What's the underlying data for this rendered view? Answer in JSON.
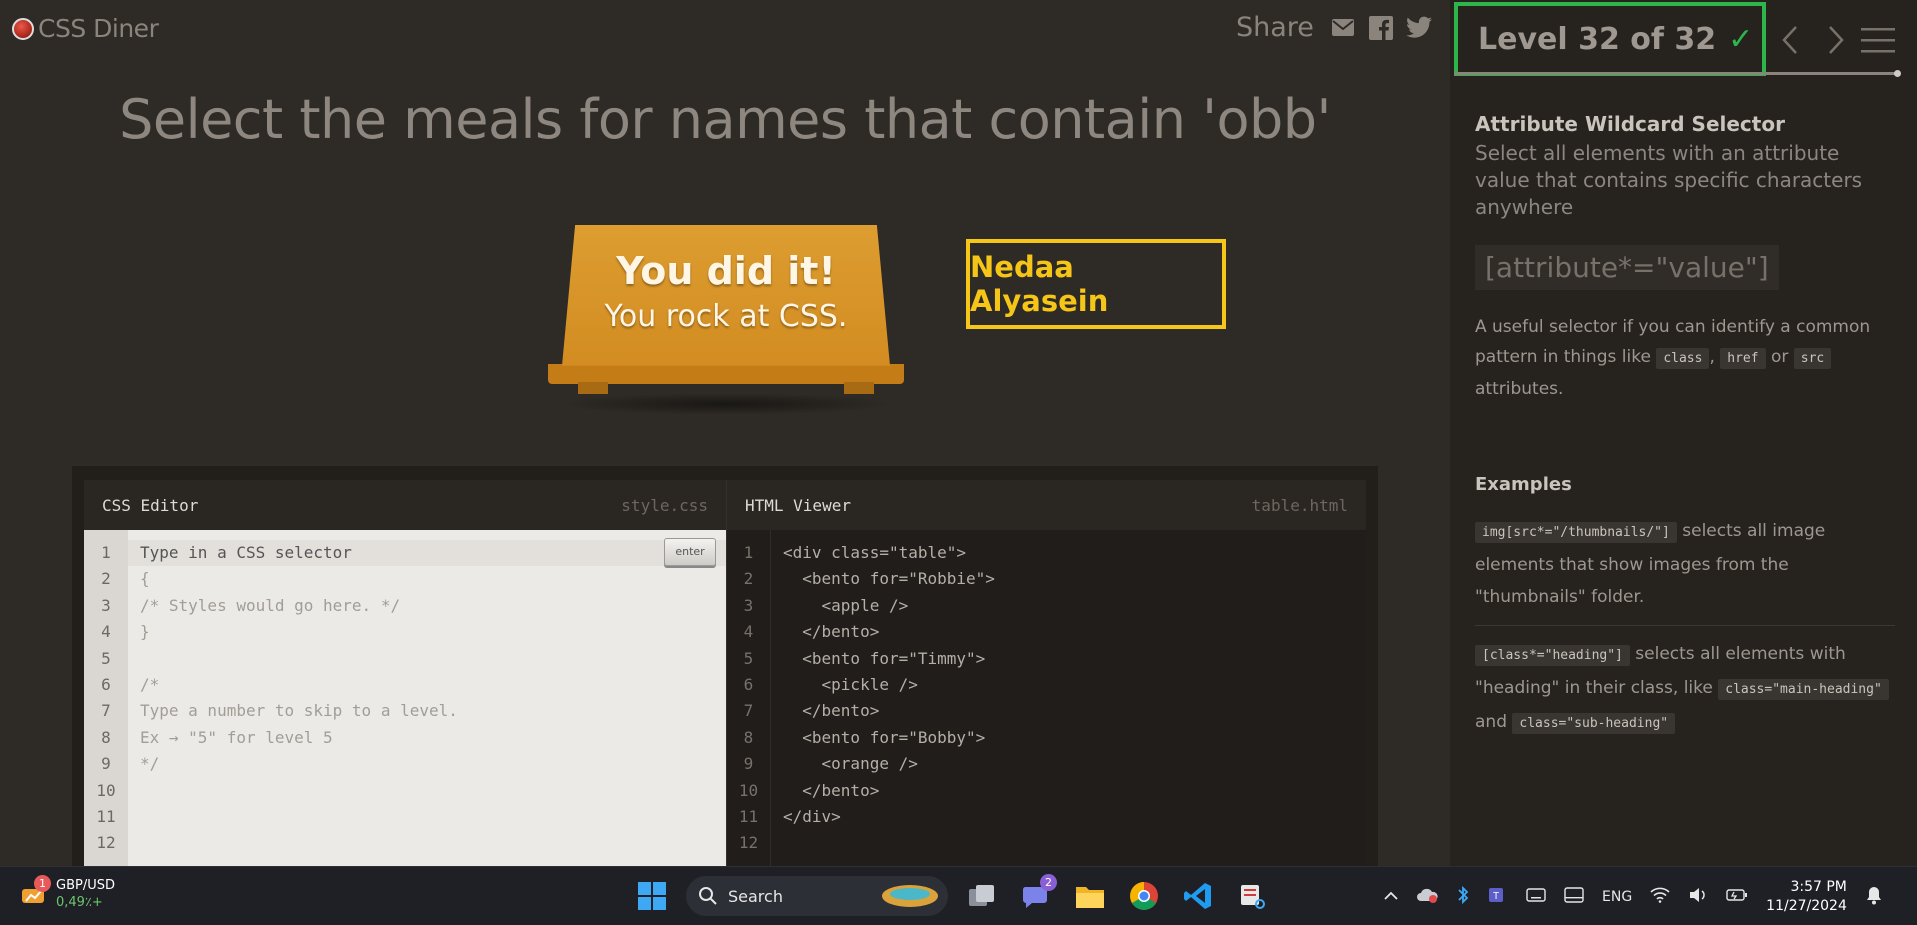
{
  "app": {
    "logo_text": "CSS Diner"
  },
  "share": {
    "label": "Share",
    "icons": [
      "mail-icon",
      "facebook-icon",
      "twitter-icon"
    ]
  },
  "order": "Select the meals for names that contain 'obb'",
  "table": {
    "title": "You did it!",
    "subtitle": "You rock at CSS."
  },
  "name_box": "Nedaa Alyasein",
  "css_editor": {
    "title": "CSS Editor",
    "file": "style.css",
    "enter_label": "enter",
    "line_numbers": [
      "1",
      "2",
      "3",
      "4",
      "5",
      "6",
      "7",
      "8",
      "9",
      "10",
      "11",
      "12"
    ],
    "lines": [
      "Type in a CSS selector",
      "{",
      "/* Styles would go here. */",
      "}",
      "",
      "/*",
      "Type a number to skip to a level.",
      "Ex → \"5\" for level 5",
      "*/",
      "",
      "",
      ""
    ]
  },
  "html_viewer": {
    "title": "HTML Viewer",
    "file": "table.html",
    "line_numbers": [
      "1",
      "2",
      "3",
      "4",
      "5",
      "6",
      "7",
      "8",
      "9",
      "10",
      "11",
      "12"
    ],
    "lines": [
      "<div class=\"table\">",
      "  <bento for=\"Robbie\">",
      "    <apple />",
      "  </bento>",
      "  <bento for=\"Timmy\">",
      "    <pickle />",
      "  </bento>",
      "  <bento for=\"Bobby\">",
      "    <orange />",
      "  </bento>",
      "</div>",
      ""
    ]
  },
  "sidebar": {
    "level_label": "Level 32 of 32",
    "check": "✓",
    "progress": 1.0,
    "selector_name": "Attribute Wildcard Selector",
    "selector_title": "Select all elements with an attribute value that contains specific characters anywhere",
    "syntax": "[attribute*=\"value\"]",
    "hint_pre": "A useful selector if you can identify a common pattern in things like",
    "hint_code1": "class",
    "hint_sep": ",",
    "hint_code2": "href",
    "hint_or": "or",
    "hint_code3": "src",
    "hint_post": "attributes.",
    "examples_heading": "Examples",
    "ex1_code": "img[src*=\"/thumbnails/\"]",
    "ex1_text": "selects all image elements that show images from the \"thumbnails\" folder.",
    "ex2_code": "[class*=\"heading\"]",
    "ex2_text": "selects all elements with \"heading\" in their class, like",
    "ex2_code2": "class=\"main-heading\"",
    "ex2_and": "and",
    "ex2_code3": "class=\"sub-heading\""
  },
  "taskbar": {
    "widget_badge": "1",
    "ticker": "GBP/USD",
    "ticker_change": "0,49٪+",
    "search_label": "Search",
    "teams_badge": "2",
    "lang": "ENG",
    "time": "3:57 PM",
    "date": "11/27/2024"
  }
}
